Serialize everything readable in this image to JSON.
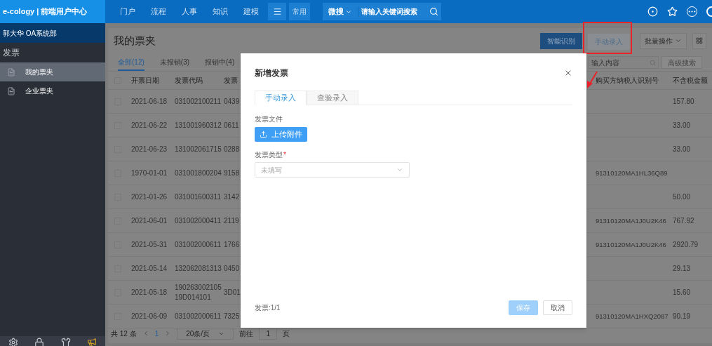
{
  "topbar": {
    "logo": "e-cology | 前端用户中心",
    "nav": [
      "门户",
      "流程",
      "人事",
      "知识",
      "建模"
    ],
    "quick": "常用",
    "search_scope": "微搜",
    "search": {
      "placeholder": "请输入关键词搜索"
    }
  },
  "sidebar": {
    "user": "郭大华 OA系统部",
    "section": "发票",
    "items": [
      {
        "label": "我的票夹",
        "selected": true
      },
      {
        "label": "企业票夹",
        "selected": false
      }
    ]
  },
  "page": {
    "title": "我的票夹",
    "actions": [
      {
        "label": "智能识别",
        "kind": "primary"
      },
      {
        "label": "手动录入",
        "kind": "plain"
      },
      {
        "label": "批量操作",
        "kind": "dropdown"
      }
    ],
    "tabs": [
      {
        "label": "全部(12)",
        "selected": true
      },
      {
        "label": "未报销(3)",
        "selected": false
      },
      {
        "label": "报销中(4)",
        "selected": false
      }
    ],
    "search": {
      "placeholder": "输入内容"
    },
    "advanced_search": "高级搜索",
    "table": {
      "select_all_checked": false,
      "columns": [
        "开票日期",
        "发票代码",
        "发票",
        "购买方纳税人识别号",
        "不含税金额"
      ],
      "rows": [
        {
          "checked": false,
          "date": "2021-06-18",
          "code": "031002100211",
          "number": "0439",
          "buyer_id": "",
          "amount": "157.80"
        },
        {
          "checked": false,
          "date": "2021-06-22",
          "code": "131001960312",
          "number": "0611",
          "buyer_id": "",
          "amount": "33.00"
        },
        {
          "checked": false,
          "date": "2021-06-23",
          "code": "131002061715",
          "number": "0288",
          "buyer_id": "",
          "amount": "33.00"
        },
        {
          "checked": false,
          "date": "1970-01-01",
          "code": "031001800204",
          "number": "9158",
          "buyer_id": "91310120MA1HL36Q89",
          "amount": ""
        },
        {
          "checked": false,
          "date": "2021-01-26",
          "code": "031001600311",
          "number": "3142",
          "buyer_id": "",
          "amount": "50.00"
        },
        {
          "checked": false,
          "date": "2021-06-01",
          "code": "031002000411",
          "number": "2119",
          "buyer_id": "91310120MA1J0U2K46",
          "amount": "767.92"
        },
        {
          "checked": false,
          "date": "2021-05-31",
          "code": "031002000611",
          "number": "1766",
          "buyer_id": "91310120MA1J0U2K46",
          "amount": "2920.79"
        },
        {
          "checked": false,
          "date": "2021-05-14",
          "code": "132062081313",
          "number": "0450",
          "buyer_id": "",
          "amount": "29.13"
        },
        {
          "checked": false,
          "date": "2021-05-18",
          "code": "19026300210519D014101",
          "number": "3D01",
          "buyer_id": "",
          "amount": "15.60"
        },
        {
          "checked": false,
          "date": "2021-06-09",
          "code": "031002000611",
          "number": "7325",
          "buyer_id": "91310120MA1HXQ2087",
          "amount": "90.19"
        }
      ]
    },
    "pagination": {
      "total": "共 12 条",
      "current": "1",
      "page_size": "20条/页",
      "goto_label": "前往",
      "goto_value": "1",
      "goto_unit": "页"
    }
  },
  "dialog": {
    "title": "新增发票",
    "tabs": [
      {
        "label": "手动录入",
        "selected": true
      },
      {
        "label": "查验录入",
        "selected": false
      }
    ],
    "file_label": "发票文件",
    "upload": "上传附件",
    "type_label": "发票类型",
    "type_required_mark": "*",
    "type_select": {
      "placeholder": "未填写"
    },
    "counter": "发票:1/1",
    "save": {
      "label": "保存",
      "disabled": true
    },
    "cancel": "取消"
  }
}
